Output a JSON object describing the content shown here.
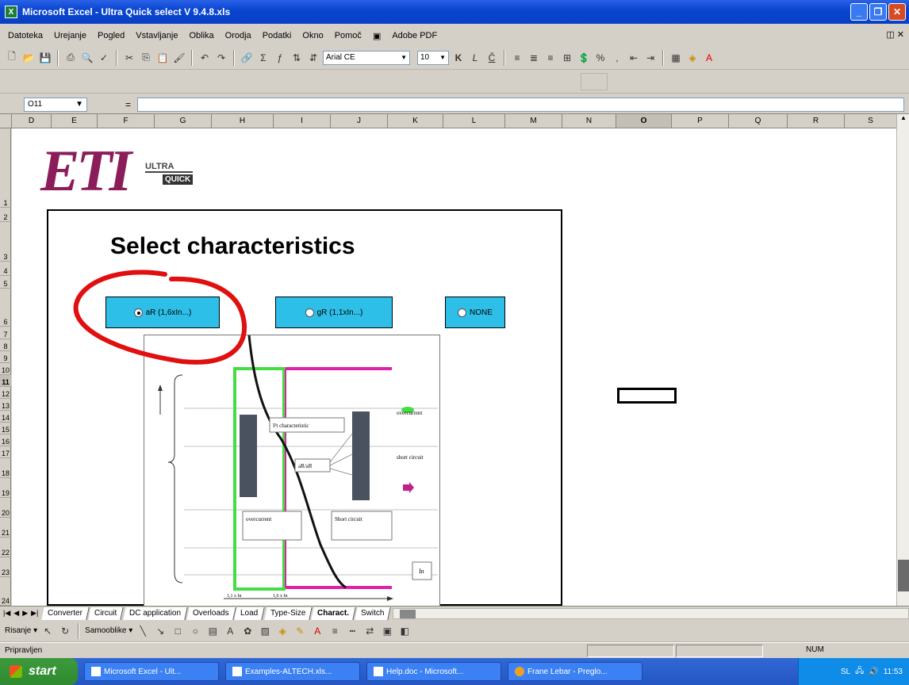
{
  "window": {
    "title": "Microsoft Excel - Ultra Quick select V 9.4.8.xls",
    "icon": "excel-icon"
  },
  "menu": {
    "items": [
      "Datoteka",
      "Urejanje",
      "Pogled",
      "Vstavljanje",
      "Oblika",
      "Orodja",
      "Podatki",
      "Okno",
      "Pomoč",
      "Adobe PDF"
    ]
  },
  "toolbar": {
    "font_name": "Arial CE",
    "font_size": "10"
  },
  "formula": {
    "name_box": "O11",
    "content": ""
  },
  "columns": [
    "D",
    "E",
    "F",
    "G",
    "H",
    "I",
    "J",
    "K",
    "L",
    "M",
    "N",
    "O",
    "P",
    "Q",
    "R",
    "S"
  ],
  "active_column": "O",
  "rows": [
    "1",
    "2",
    "3",
    "4",
    "5",
    "6",
    "7",
    "8",
    "9",
    "10",
    "11",
    "12",
    "13",
    "14",
    "15",
    "16",
    "17",
    "18",
    "19",
    "20",
    "21",
    "22",
    "23",
    "24"
  ],
  "active_row": "11",
  "logo": {
    "brand": "ETI",
    "ultra": "ULTRA",
    "quick": "QUICK"
  },
  "panel": {
    "title": "Select characteristics",
    "options": [
      {
        "label": "aR (1,6xIn...)",
        "checked": true
      },
      {
        "label": "gR (1,1xIn...)",
        "checked": false
      },
      {
        "label": "NONE",
        "checked": false
      }
    ]
  },
  "diagram": {
    "labels": {
      "i2t": "I²t characteristic",
      "aR_label": "aR/aR",
      "overcurrent": "overcurrent",
      "short_circuit_right": "short circuit",
      "short_circuit_box": "Short circuit",
      "in_box": "In",
      "x_label1": "1,1 x In",
      "x_label2": "1,6 x In"
    }
  },
  "sheet_tabs": [
    "Converter",
    "Circuit",
    "DC application",
    "Overloads",
    "Load",
    "Type-Size",
    "Charact.",
    "Switch"
  ],
  "active_tab": "Charact.",
  "drawbar": {
    "risanje": "Risanje",
    "samooblike": "Samooblike"
  },
  "status": {
    "text": "Pripravljen",
    "num": "NUM"
  },
  "taskbar": {
    "start": "start",
    "tasks": [
      "Microsoft Excel - Ult...",
      "Examples-ALTECH.xls...",
      "Help.doc - Microsoft...",
      "Frane Lebar - Preglo..."
    ],
    "clock": "11:53",
    "lang": "SL"
  },
  "colors": {
    "brand": "#8b1e5a",
    "option_bg": "#2dbfe8",
    "green_line": "#44dd44",
    "magenta_line": "#dd22aa",
    "annotation": "#e01010"
  }
}
